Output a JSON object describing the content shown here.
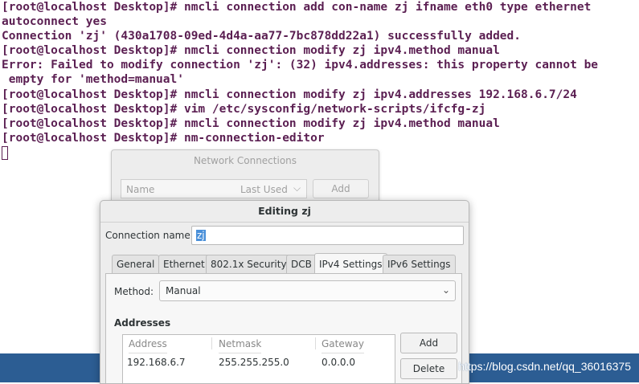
{
  "terminal": {
    "lines": [
      "[root@localhost Desktop]# nmcli connection add con-name zj ifname eth0 type ethernet",
      "autoconnect yes",
      "Connection 'zj' (430a1708-09ed-4d4a-aa77-7bc878dd22a1) successfully added.",
      "[root@localhost Desktop]# nmcli connection modify zj ipv4.method manual",
      "Error: Failed to modify connection 'zj': (32) ipv4.addresses: this property cannot be",
      " empty for 'method=manual'",
      "[root@localhost Desktop]# nmcli connection modify zj ipv4.addresses 192.168.6.7/24",
      "[root@localhost Desktop]# vim /etc/sysconfig/network-scripts/ifcfg-zj",
      "[root@localhost Desktop]# nmcli connection modify zj ipv4.method manual",
      "[root@localhost Desktop]# nm-connection-editor"
    ]
  },
  "network_connections": {
    "title": "Network Connections",
    "col_name": "Name",
    "col_last_used": "Last Used",
    "add_label": "Add"
  },
  "editing": {
    "title": "Editing zj",
    "connection_name_label": "Connection name:",
    "connection_name_value": "zj",
    "tabs": [
      "General",
      "Ethernet",
      "802.1x Security",
      "DCB",
      "IPv4 Settings",
      "IPv6 Settings"
    ],
    "active_tab": "IPv4 Settings",
    "method_label": "Method:",
    "method_value": "Manual",
    "addresses_heading": "Addresses",
    "columns": [
      "Address",
      "Netmask",
      "Gateway"
    ],
    "rows": [
      {
        "address": "192.168.6.7",
        "netmask": "255.255.255.0",
        "gateway": "0.0.0.0"
      }
    ],
    "add_label": "Add",
    "delete_label": "Delete"
  },
  "watermark": "https://blog.csdn.net/qq_36016375",
  "colors": {
    "terminal_text": "#5b1f52",
    "taskbar": "#2c5d93",
    "selection": "#4a90d9"
  }
}
